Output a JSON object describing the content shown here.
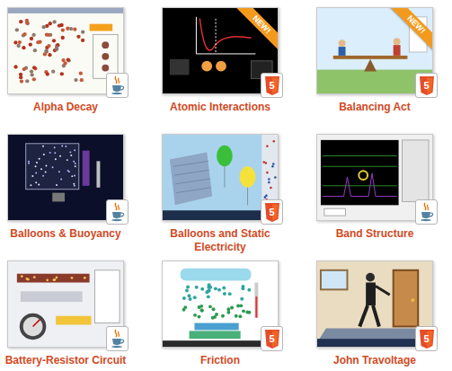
{
  "tiles": [
    {
      "title": "Alpha Decay",
      "kind": "java",
      "new": false
    },
    {
      "title": "Atomic Interactions",
      "kind": "html5",
      "badge_label": "5",
      "new": true,
      "ribbon_label": "NEW!"
    },
    {
      "title": "Balancing Act",
      "kind": "html5",
      "badge_label": "5",
      "new": true,
      "ribbon_label": "NEW!"
    },
    {
      "title": "Balloons & Buoyancy",
      "kind": "java",
      "new": false
    },
    {
      "title": "Balloons and Static Electricity",
      "kind": "html5",
      "badge_label": "5",
      "new": false
    },
    {
      "title": "Band Structure",
      "kind": "java",
      "new": false
    },
    {
      "title": "Battery-Resistor Circuit",
      "kind": "java",
      "new": false
    },
    {
      "title": "Friction",
      "kind": "html5",
      "badge_label": "5",
      "new": false
    },
    {
      "title": "John Travoltage",
      "kind": "html5",
      "badge_label": "5",
      "new": false
    }
  ]
}
